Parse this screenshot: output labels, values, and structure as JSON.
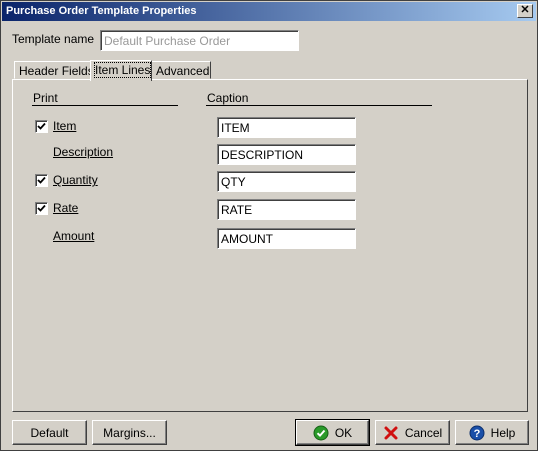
{
  "window": {
    "title": "Purchase Order Template Properties",
    "close_label": "✕"
  },
  "template_name": {
    "label": "Template name",
    "value": "Default Purchase Order"
  },
  "tabs": [
    {
      "label": "Header Fields",
      "active": false
    },
    {
      "label": "Item Lines",
      "active": true
    },
    {
      "label": "Advanced",
      "active": false
    }
  ],
  "columns": {
    "print": "Print",
    "caption": "Caption"
  },
  "rows": [
    {
      "label": "Item",
      "checkbox": true,
      "checked": true,
      "caption": "ITEM"
    },
    {
      "label": "Description",
      "checkbox": false,
      "checked": false,
      "caption": "DESCRIPTION"
    },
    {
      "label": "Quantity",
      "checkbox": true,
      "checked": true,
      "caption": "QTY"
    },
    {
      "label": "Rate",
      "checkbox": true,
      "checked": true,
      "caption": "RATE"
    },
    {
      "label": "Amount",
      "checkbox": false,
      "checked": false,
      "caption": "AMOUNT"
    }
  ],
  "buttons": {
    "default": "Default",
    "margins": "Margins...",
    "ok": "OK",
    "cancel": "Cancel",
    "help": "Help"
  },
  "icons": {
    "ok": "check-circle-icon",
    "cancel": "red-x-icon",
    "help": "question-circle-icon"
  },
  "colors": {
    "titlebar_start": "#0a246a",
    "titlebar_end": "#a6caf0",
    "ok_green": "#2a9a2a",
    "cancel_red": "#d01010",
    "help_blue": "#1a4fa8"
  }
}
